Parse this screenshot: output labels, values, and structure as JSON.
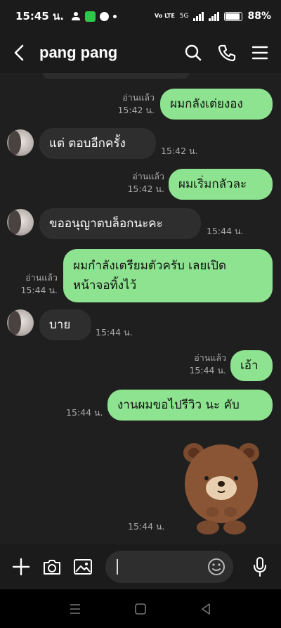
{
  "status": {
    "time": "15:45 น.",
    "battery": "88%",
    "network": "5G",
    "volte": "Vo LTE"
  },
  "header": {
    "title": "pang pang",
    "icons": [
      "back-icon",
      "search-icon",
      "phone-icon",
      "menu-icon"
    ]
  },
  "messages": [
    {
      "dir": "out",
      "text": "ผมกลังเต่ยงอง",
      "read": "อ่านแล้ว",
      "time": "15:42 น."
    },
    {
      "dir": "in",
      "text": "แต่ ตอบอีกครั้ง",
      "time": "15:42 น."
    },
    {
      "dir": "out",
      "text": "ผมเริ่มกลัวละ",
      "read": "อ่านแล้ว",
      "time": "15:42 น."
    },
    {
      "dir": "in",
      "text": "ขออนุญาตบล็อกนะคะ",
      "time": "15:44 น."
    },
    {
      "dir": "out",
      "line1": "ผมกำลังเตรียมตัวครับ เลยเปิด",
      "line2": "หน้าจอทิ้งไว้",
      "read": "อ่านแล้ว",
      "time": "15:44 น."
    },
    {
      "dir": "in",
      "text": "บาย",
      "time": "15:44 น."
    },
    {
      "dir": "out",
      "text": "เอ้า",
      "read": "อ่านแล้ว",
      "time": "15:44 น."
    },
    {
      "dir": "out",
      "text": "งานผมขอไปรีวิว นะ คับ",
      "time": "15:44 น."
    },
    {
      "dir": "in",
      "sticker": "brown-bear-sticker",
      "time": "15:44 น."
    }
  ],
  "input": {
    "placeholder": "",
    "icons": [
      "plus-icon",
      "camera-icon",
      "image-icon",
      "emoji-icon",
      "mic-icon"
    ]
  },
  "colors": {
    "outgoing_bubble": "#8de38f",
    "incoming_bubble": "#2e2e2e",
    "chat_bg": "#1f1f1f"
  }
}
